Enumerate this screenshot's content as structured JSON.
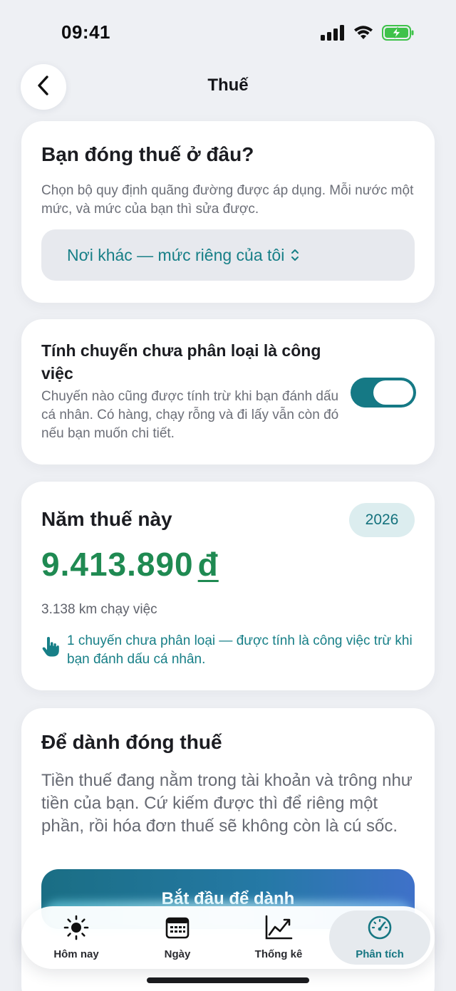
{
  "status_bar": {
    "time": "09:41"
  },
  "nav": {
    "title": "Thuế"
  },
  "region_card": {
    "title": "Bạn đóng thuế ở đâu?",
    "description": "Chọn bộ quy định quãng đường được áp dụng. Mỗi nước một mức, và mức của bạn thì sửa được.",
    "select_value": "Nơi khác — mức riêng của tôi"
  },
  "unclassified_card": {
    "title": "Tính chuyến chưa phân loại là công việc",
    "description": "Chuyến nào cũng được tính trừ khi bạn đánh dấu cá nhân. Có hàng, chạy rỗng và đi lấy vẫn còn đó nếu bạn muốn chi tiết.",
    "toggle_on": true
  },
  "tax_year_card": {
    "title": "Năm thuế này",
    "year": "2026",
    "amount": "9.413.890",
    "currency": "đ",
    "km_text": "3.138 km chạy việc",
    "note": "1 chuyến chưa phân loại — được tính là công việc trừ khi bạn đánh dấu cá nhân."
  },
  "save_card": {
    "title": "Để dành đóng thuế",
    "description": "Tiền thuế đang nằm trong tài khoản và trông như tiền của bạn. Cứ kiếm được thì để riêng một phần, rồi hóa đơn thuế sẽ không còn là cú sốc.",
    "button_label": "Bắt đầu để dành"
  },
  "tab_bar": {
    "tabs": [
      {
        "label": "Hôm nay",
        "icon": "sun-icon"
      },
      {
        "label": "Ngày",
        "icon": "calendar-icon"
      },
      {
        "label": "Thống kê",
        "icon": "chart-icon"
      },
      {
        "label": "Phân tích",
        "icon": "gauge-icon",
        "active": true
      }
    ]
  },
  "colors": {
    "accent": "#177f87",
    "amount_green": "#1f8a52",
    "toggle_on": "#157985",
    "background": "#eef0f4"
  }
}
